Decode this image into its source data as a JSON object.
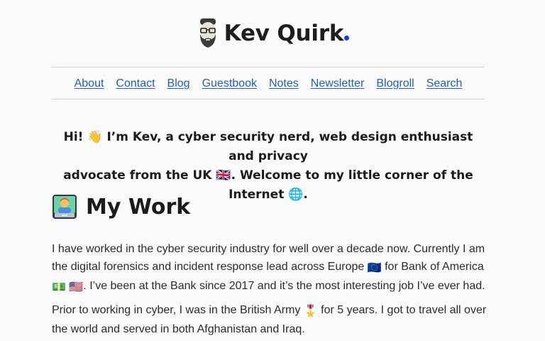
{
  "site": {
    "title": "Kev Quirk",
    "brand_dot_color": "#1440c8",
    "logo_icon": "bearded-man-avatar-icon"
  },
  "nav": {
    "items": [
      {
        "label": "About"
      },
      {
        "label": "Contact"
      },
      {
        "label": "Blog"
      },
      {
        "label": "Guestbook"
      },
      {
        "label": "Notes"
      },
      {
        "label": "Newsletter"
      },
      {
        "label": "Blogroll"
      },
      {
        "label": "Search"
      }
    ],
    "link_color": "#1f5eb4"
  },
  "intro": {
    "greeting": "Hi!",
    "wave_emoji": "👋",
    "line1": "I’m Kev, a cyber security nerd, web design enthusiast and privacy",
    "line2_a": "advocate from the UK",
    "uk_flag": "🇬🇧",
    "line2_b": ". Welcome to my little corner of the Internet",
    "globe_emoji": "🌐",
    "line2_end": "."
  },
  "work": {
    "icon": "technologist-icon",
    "heading": "My Work",
    "p1_a": "I have worked in the cyber security industry for well over a decade now. Currently I am the digital forensics and incident response lead across Europe",
    "eu_flag": "🇪🇺",
    "p1_b": "for Bank of America",
    "money_emoji": "💵",
    "us_flag": "🇺🇸",
    "p1_c": ". I’ve been at the Bank since 2017 and it’s the most interesting job I’ve ever had.",
    "p2_a": "Prior to working in cyber, I was in the British Army",
    "medal_emoji": "🎖️",
    "p2_b": "for 5 years. I got to travel all over the world and served in both Afghanistan and Iraq."
  }
}
